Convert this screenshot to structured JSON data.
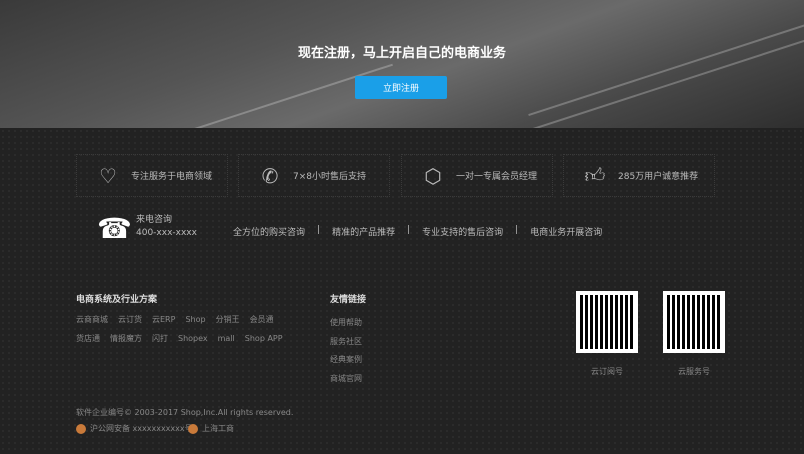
{
  "hero": {
    "title": "现在注册，马上开启自己的电商业务",
    "register_label": "立即注册"
  },
  "features": [
    {
      "icon": "heart-icon",
      "label": "专注服务于电商领域"
    },
    {
      "icon": "phone-icon",
      "label": "7×8小时售后支持"
    },
    {
      "icon": "user-icon",
      "label": "一对一专属会员经理"
    },
    {
      "icon": "thumbs-up-icon",
      "label": "285万用户诚意推荐"
    }
  ],
  "contact": {
    "title": "来电咨询",
    "phone": "400-xxx-xxxx",
    "services": [
      "全方位的购买咨询",
      "|",
      "精准的产品推荐",
      "|",
      "专业支持的售后咨询",
      "|",
      "电商业务开展咨询"
    ]
  },
  "solutions": {
    "title": "电商系统及行业方案",
    "row1": [
      "云商商城",
      "云订货",
      "云ERP",
      "Shop",
      "分销王",
      "会员通"
    ],
    "row2": [
      "货店通",
      "情报魔方",
      "闪打",
      "Shopex",
      "mall",
      "Shop APP"
    ]
  },
  "friend_links": {
    "title": "友情链接",
    "items": [
      "使用帮助",
      "服务社区",
      "经典案例",
      "商城官网"
    ]
  },
  "qr": [
    {
      "label": "云订阅号"
    },
    {
      "label": "云服务号"
    }
  ],
  "copyright": "软件企业编号© 2003-2017 Shop,Inc.All rights reserved.",
  "badges": [
    "沪公网安备 xxxxxxxxxxx号",
    "上海工商"
  ]
}
